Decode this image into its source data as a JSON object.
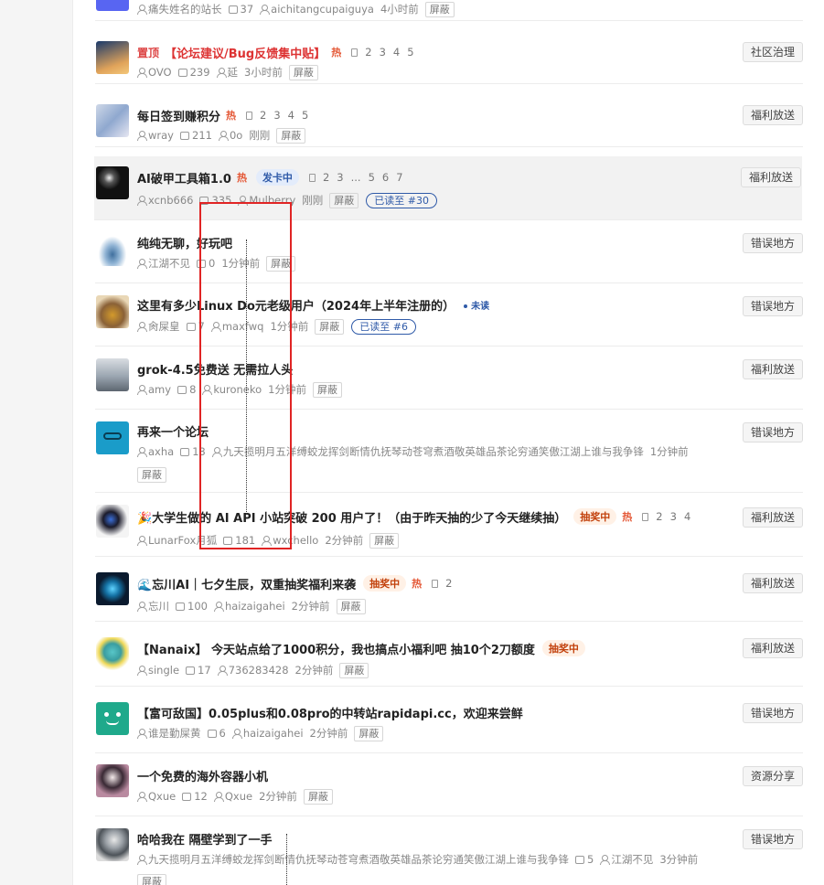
{
  "colors": {
    "accent_blue": "#2f5aa8",
    "hot_red": "#e45735",
    "pinned_red": "#d33333",
    "highlight_box": "#e02424"
  },
  "topics": [
    {
      "title": "",
      "meta": [
        {
          "icon": "person-icon",
          "text": "痛失姓名的站长"
        },
        {
          "icon": "chat-icon",
          "text": "37"
        },
        {
          "icon": "person-icon",
          "text": "aichitangcupaiguya"
        },
        {
          "text": "4小时前"
        }
      ],
      "block_label": "屏蔽",
      "category": ""
    },
    {
      "pinned_label": "置顶",
      "title": "【论坛建议/Bug反馈集中贴】",
      "hot": "热",
      "pages": [
        "2",
        "3",
        "4",
        "5"
      ],
      "meta": [
        {
          "icon": "person-icon",
          "text": "OVO"
        },
        {
          "icon": "chat-icon",
          "text": "239"
        },
        {
          "icon": "person-icon",
          "text": "延"
        },
        {
          "text": "3小时前"
        }
      ],
      "block_label": "屏蔽",
      "category": "社区治理"
    },
    {
      "title": "每日签到赚积分",
      "hot": "热",
      "pages": [
        "2",
        "3",
        "4",
        "5"
      ],
      "meta": [
        {
          "icon": "person-icon",
          "text": "wray"
        },
        {
          "icon": "chat-icon",
          "text": "211"
        },
        {
          "icon": "person-icon",
          "text": "0o"
        },
        {
          "text": "刚刚"
        }
      ],
      "block_label": "屏蔽",
      "category": "福利放送"
    },
    {
      "title": "AI破甲工具箱1.0",
      "hot": "热",
      "badge": "发卡中",
      "pages": [
        "2",
        "3",
        "...",
        "5",
        "6",
        "7"
      ],
      "meta": [
        {
          "icon": "person-icon",
          "text": "xcnb666"
        },
        {
          "icon": "chat-icon",
          "text": "335"
        },
        {
          "icon": "person-icon",
          "text": "Mulberry"
        },
        {
          "text": "刚刚"
        }
      ],
      "block_label": "屏蔽",
      "read_chip": "已读至 #30",
      "category": "福利放送"
    },
    {
      "title": "纯纯无聊，好玩吧",
      "meta": [
        {
          "icon": "person-icon",
          "text": "江湖不见"
        },
        {
          "icon": "chat-icon",
          "text": "0"
        },
        {
          "text": "1分钟前"
        }
      ],
      "block_label": "屏蔽",
      "category": "错误地方"
    },
    {
      "title": "这里有多少Linux Do元老级用户（2024年上半年注册的）",
      "unread": "未读",
      "meta": [
        {
          "icon": "person-icon",
          "text": "肏屎皇"
        },
        {
          "icon": "chat-icon",
          "text": "7"
        },
        {
          "icon": "person-icon",
          "text": "maxfwq"
        },
        {
          "text": "1分钟前"
        }
      ],
      "block_label": "屏蔽",
      "read_chip": "已读至 #6",
      "category": "错误地方"
    },
    {
      "title": "grok-4.5免费送 无需拉人头",
      "meta": [
        {
          "icon": "person-icon",
          "text": "amy"
        },
        {
          "icon": "chat-icon",
          "text": "8"
        },
        {
          "icon": "person-icon",
          "text": "kuroneko"
        },
        {
          "text": "1分钟前"
        }
      ],
      "block_label": "屏蔽",
      "category": "福利放送"
    },
    {
      "title": "再来一个论坛",
      "meta": [
        {
          "icon": "person-icon",
          "text": "axha"
        },
        {
          "icon": "chat-icon",
          "text": "13"
        },
        {
          "icon": "person-icon",
          "text": "九天揽明月五洋缚蛟龙挥剑断情仇抚琴动苍穹煮酒敬英雄品茶论穷通笑傲江湖上谁与我争锋"
        },
        {
          "text": "1分钟前"
        }
      ],
      "block_label": "屏蔽",
      "category": "错误地方"
    },
    {
      "title": "🎉大学生做的 AI API 小站突破 200 用户了！（由于昨天抽的少了今天继续抽）",
      "badge_orange": "抽奖中",
      "hot": "热",
      "pages": [
        "2",
        "3",
        "4"
      ],
      "meta": [
        {
          "icon": "person-icon",
          "text": "LunarFox月狐"
        },
        {
          "icon": "chat-icon",
          "text": "181"
        },
        {
          "icon": "person-icon",
          "text": "wxchello"
        },
        {
          "text": "2分钟前"
        }
      ],
      "block_label": "屏蔽",
      "category": "福利放送"
    },
    {
      "title": "🌊忘川AI｜七夕生辰，双重抽奖福利来袭",
      "badge_orange": "抽奖中",
      "hot": "热",
      "pages": [
        "2"
      ],
      "meta": [
        {
          "icon": "person-icon",
          "text": "忘川"
        },
        {
          "icon": "chat-icon",
          "text": "100"
        },
        {
          "icon": "person-icon",
          "text": "haizaigahei"
        },
        {
          "text": "2分钟前"
        }
      ],
      "block_label": "屏蔽",
      "category": "福利放送"
    },
    {
      "title": "【Nanaix】 今天站点给了1000积分，我也搞点小福利吧 抽10个2刀额度",
      "badge_orange": "抽奖中",
      "meta": [
        {
          "icon": "person-icon",
          "text": "single"
        },
        {
          "icon": "chat-icon",
          "text": "17"
        },
        {
          "icon": "person-icon",
          "text": "736283428"
        },
        {
          "text": "2分钟前"
        }
      ],
      "block_label": "屏蔽",
      "category": "福利放送"
    },
    {
      "title": "【富可敌国】0.05plus和0.08pro的中转站rapidapi.cc，欢迎来尝鲜",
      "meta": [
        {
          "icon": "person-icon",
          "text": "谁是勤屎黄"
        },
        {
          "icon": "chat-icon",
          "text": "6"
        },
        {
          "icon": "person-icon",
          "text": "haizaigahei"
        },
        {
          "text": "2分钟前"
        }
      ],
      "block_label": "屏蔽",
      "category": "错误地方"
    },
    {
      "title": "一个免费的海外容器小机",
      "meta": [
        {
          "icon": "person-icon",
          "text": "Qxue"
        },
        {
          "icon": "chat-icon",
          "text": "12"
        },
        {
          "icon": "person-icon",
          "text": "Qxue"
        },
        {
          "text": "2分钟前"
        }
      ],
      "block_label": "屏蔽",
      "category": "资源分享"
    },
    {
      "title": "哈哈我在 隔壁学到了一手",
      "meta": [
        {
          "icon": "person-icon",
          "text": "九天揽明月五洋缚蛟龙挥剑断情仇抚琴动苍穹煮酒敬英雄品茶论穷通笑傲江湖上谁与我争锋"
        },
        {
          "icon": "chat-icon",
          "text": "5"
        },
        {
          "icon": "person-icon",
          "text": "江湖不见"
        },
        {
          "text": "3分钟前"
        }
      ],
      "block_label": "屏蔽",
      "category": "错误地方"
    }
  ]
}
